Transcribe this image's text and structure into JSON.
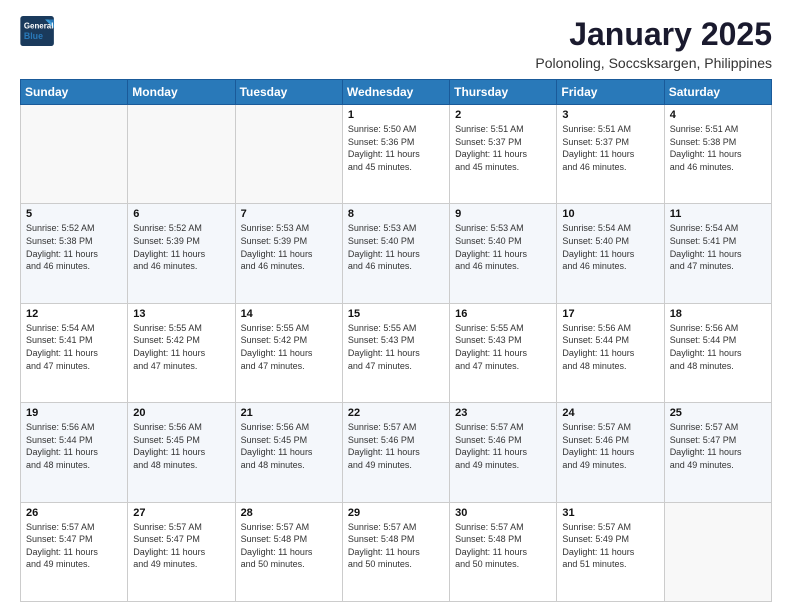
{
  "logo": {
    "line1": "General",
    "line2": "Blue"
  },
  "title": "January 2025",
  "subtitle": "Polonoling, Soccsksargen, Philippines",
  "days_of_week": [
    "Sunday",
    "Monday",
    "Tuesday",
    "Wednesday",
    "Thursday",
    "Friday",
    "Saturday"
  ],
  "weeks": [
    [
      {
        "day": "",
        "info": ""
      },
      {
        "day": "",
        "info": ""
      },
      {
        "day": "",
        "info": ""
      },
      {
        "day": "1",
        "info": "Sunrise: 5:50 AM\nSunset: 5:36 PM\nDaylight: 11 hours\nand 45 minutes."
      },
      {
        "day": "2",
        "info": "Sunrise: 5:51 AM\nSunset: 5:37 PM\nDaylight: 11 hours\nand 45 minutes."
      },
      {
        "day": "3",
        "info": "Sunrise: 5:51 AM\nSunset: 5:37 PM\nDaylight: 11 hours\nand 46 minutes."
      },
      {
        "day": "4",
        "info": "Sunrise: 5:51 AM\nSunset: 5:38 PM\nDaylight: 11 hours\nand 46 minutes."
      }
    ],
    [
      {
        "day": "5",
        "info": "Sunrise: 5:52 AM\nSunset: 5:38 PM\nDaylight: 11 hours\nand 46 minutes."
      },
      {
        "day": "6",
        "info": "Sunrise: 5:52 AM\nSunset: 5:39 PM\nDaylight: 11 hours\nand 46 minutes."
      },
      {
        "day": "7",
        "info": "Sunrise: 5:53 AM\nSunset: 5:39 PM\nDaylight: 11 hours\nand 46 minutes."
      },
      {
        "day": "8",
        "info": "Sunrise: 5:53 AM\nSunset: 5:40 PM\nDaylight: 11 hours\nand 46 minutes."
      },
      {
        "day": "9",
        "info": "Sunrise: 5:53 AM\nSunset: 5:40 PM\nDaylight: 11 hours\nand 46 minutes."
      },
      {
        "day": "10",
        "info": "Sunrise: 5:54 AM\nSunset: 5:40 PM\nDaylight: 11 hours\nand 46 minutes."
      },
      {
        "day": "11",
        "info": "Sunrise: 5:54 AM\nSunset: 5:41 PM\nDaylight: 11 hours\nand 47 minutes."
      }
    ],
    [
      {
        "day": "12",
        "info": "Sunrise: 5:54 AM\nSunset: 5:41 PM\nDaylight: 11 hours\nand 47 minutes."
      },
      {
        "day": "13",
        "info": "Sunrise: 5:55 AM\nSunset: 5:42 PM\nDaylight: 11 hours\nand 47 minutes."
      },
      {
        "day": "14",
        "info": "Sunrise: 5:55 AM\nSunset: 5:42 PM\nDaylight: 11 hours\nand 47 minutes."
      },
      {
        "day": "15",
        "info": "Sunrise: 5:55 AM\nSunset: 5:43 PM\nDaylight: 11 hours\nand 47 minutes."
      },
      {
        "day": "16",
        "info": "Sunrise: 5:55 AM\nSunset: 5:43 PM\nDaylight: 11 hours\nand 47 minutes."
      },
      {
        "day": "17",
        "info": "Sunrise: 5:56 AM\nSunset: 5:44 PM\nDaylight: 11 hours\nand 48 minutes."
      },
      {
        "day": "18",
        "info": "Sunrise: 5:56 AM\nSunset: 5:44 PM\nDaylight: 11 hours\nand 48 minutes."
      }
    ],
    [
      {
        "day": "19",
        "info": "Sunrise: 5:56 AM\nSunset: 5:44 PM\nDaylight: 11 hours\nand 48 minutes."
      },
      {
        "day": "20",
        "info": "Sunrise: 5:56 AM\nSunset: 5:45 PM\nDaylight: 11 hours\nand 48 minutes."
      },
      {
        "day": "21",
        "info": "Sunrise: 5:56 AM\nSunset: 5:45 PM\nDaylight: 11 hours\nand 48 minutes."
      },
      {
        "day": "22",
        "info": "Sunrise: 5:57 AM\nSunset: 5:46 PM\nDaylight: 11 hours\nand 49 minutes."
      },
      {
        "day": "23",
        "info": "Sunrise: 5:57 AM\nSunset: 5:46 PM\nDaylight: 11 hours\nand 49 minutes."
      },
      {
        "day": "24",
        "info": "Sunrise: 5:57 AM\nSunset: 5:46 PM\nDaylight: 11 hours\nand 49 minutes."
      },
      {
        "day": "25",
        "info": "Sunrise: 5:57 AM\nSunset: 5:47 PM\nDaylight: 11 hours\nand 49 minutes."
      }
    ],
    [
      {
        "day": "26",
        "info": "Sunrise: 5:57 AM\nSunset: 5:47 PM\nDaylight: 11 hours\nand 49 minutes."
      },
      {
        "day": "27",
        "info": "Sunrise: 5:57 AM\nSunset: 5:47 PM\nDaylight: 11 hours\nand 49 minutes."
      },
      {
        "day": "28",
        "info": "Sunrise: 5:57 AM\nSunset: 5:48 PM\nDaylight: 11 hours\nand 50 minutes."
      },
      {
        "day": "29",
        "info": "Sunrise: 5:57 AM\nSunset: 5:48 PM\nDaylight: 11 hours\nand 50 minutes."
      },
      {
        "day": "30",
        "info": "Sunrise: 5:57 AM\nSunset: 5:48 PM\nDaylight: 11 hours\nand 50 minutes."
      },
      {
        "day": "31",
        "info": "Sunrise: 5:57 AM\nSunset: 5:49 PM\nDaylight: 11 hours\nand 51 minutes."
      },
      {
        "day": "",
        "info": ""
      }
    ]
  ]
}
